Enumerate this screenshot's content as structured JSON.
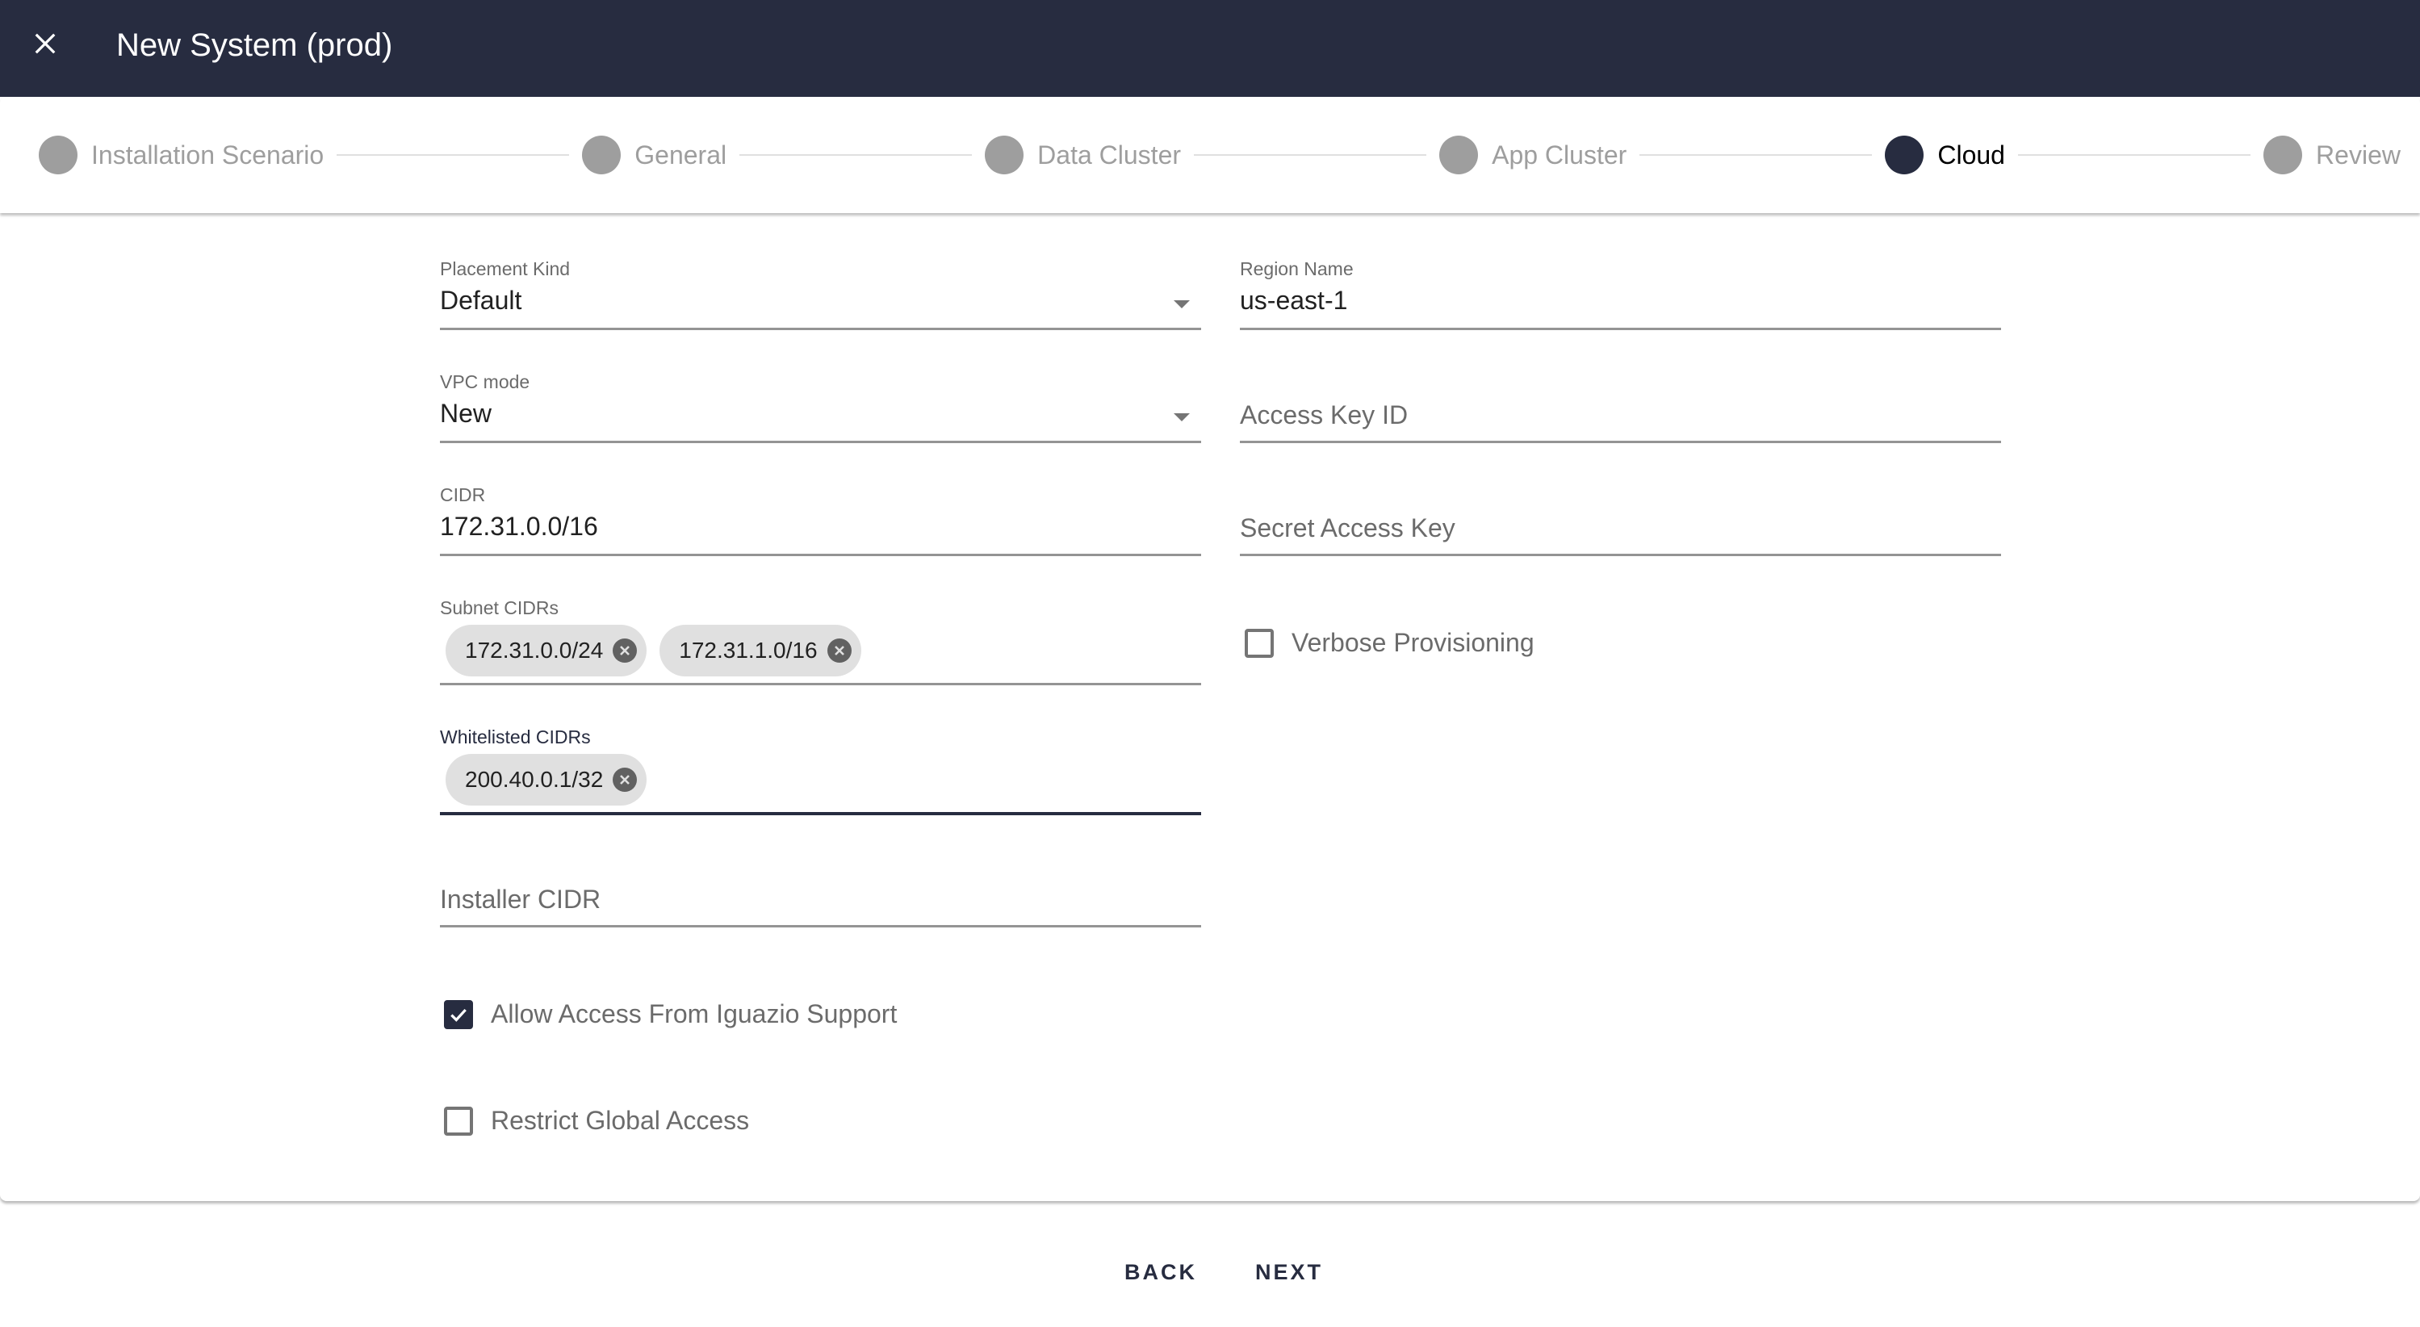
{
  "header": {
    "title": "New System (prod)",
    "close_icon": "close-icon",
    "background_color": "#272c40"
  },
  "stepper": {
    "steps": [
      {
        "label": "Installation Scenario",
        "active": false
      },
      {
        "label": "General",
        "active": false
      },
      {
        "label": "Data Cluster",
        "active": false
      },
      {
        "label": "App Cluster",
        "active": false
      },
      {
        "label": "Cloud",
        "active": true
      },
      {
        "label": "Review",
        "active": false
      }
    ],
    "active_color": "#272c40",
    "inactive_color": "#9e9e9e"
  },
  "form": {
    "placement_kind": {
      "label": "Placement Kind",
      "value": "Default",
      "type": "select"
    },
    "vpc_mode": {
      "label": "VPC mode",
      "value": "New",
      "type": "select"
    },
    "cidr": {
      "label": "CIDR",
      "value": "172.31.0.0/16"
    },
    "subnet_cidrs": {
      "label": "Subnet CIDRs",
      "chips": [
        "172.31.0.0/24",
        "172.31.1.0/16"
      ]
    },
    "whitelisted_cidrs": {
      "label": "Whitelisted CIDRs",
      "chips": [
        "200.40.0.1/32"
      ],
      "focused": true
    },
    "installer_cidr": {
      "placeholder": "Installer CIDR",
      "value": ""
    },
    "allow_access_support": {
      "label": "Allow Access From Iguazio Support",
      "checked": true
    },
    "restrict_global_access": {
      "label": "Restrict Global Access",
      "checked": false
    },
    "region_name": {
      "label": "Region Name",
      "value": "us-east-1"
    },
    "access_key_id": {
      "placeholder": "Access Key ID",
      "value": ""
    },
    "secret_access_key": {
      "placeholder": "Secret Access Key",
      "value": ""
    },
    "verbose_provisioning": {
      "label": "Verbose Provisioning",
      "checked": false
    }
  },
  "footer": {
    "back_label": "BACK",
    "next_label": "NEXT"
  }
}
